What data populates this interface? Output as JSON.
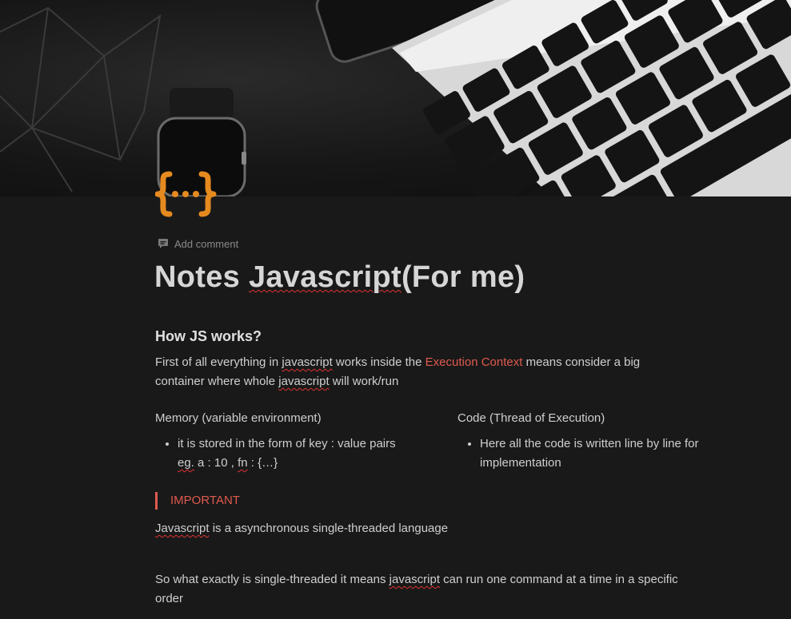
{
  "cover": {
    "description_icon": "laptop-keyboard-photo"
  },
  "page_icon": "curly-braces-icon",
  "add_comment": {
    "label": "Add comment",
    "icon": "comment-icon"
  },
  "title": {
    "part1": "Notes ",
    "part2": "Javascript",
    "part3": "(For me)"
  },
  "section1": {
    "heading": "How JS works?",
    "p1_a": "First of all everything in ",
    "p1_b": "javascript",
    "p1_c": " works inside the ",
    "p1_highlight": "Execution Context",
    "p1_d": " means consider a big",
    "p1_e": "container where whole ",
    "p1_f": "javascript",
    "p1_g": " will work/run"
  },
  "columns": {
    "left": {
      "title": "Memory (variable environment)",
      "item_line1": "it is stored in the form of key : value pairs",
      "item_eg": "eg.",
      "item_mid": " a : 10 , ",
      "item_fn": "fn",
      "item_end": " : {…}"
    },
    "right": {
      "title": "Code (Thread of Execution)",
      "item": "Here all the code is written line by line for implementation"
    }
  },
  "callout": {
    "text": "IMPORTANT"
  },
  "important_para": {
    "a": "Javascript",
    "b": " is a asynchronous single-threaded language"
  },
  "single_para": {
    "a": "So what exactly is single-threaded it means ",
    "b": "javascript",
    "c": " can run one command at a time in a specific",
    "d": "order"
  },
  "colors": {
    "accent_red": "#e05a4f",
    "icon_orange": "#e58a1f",
    "background": "#191919"
  }
}
